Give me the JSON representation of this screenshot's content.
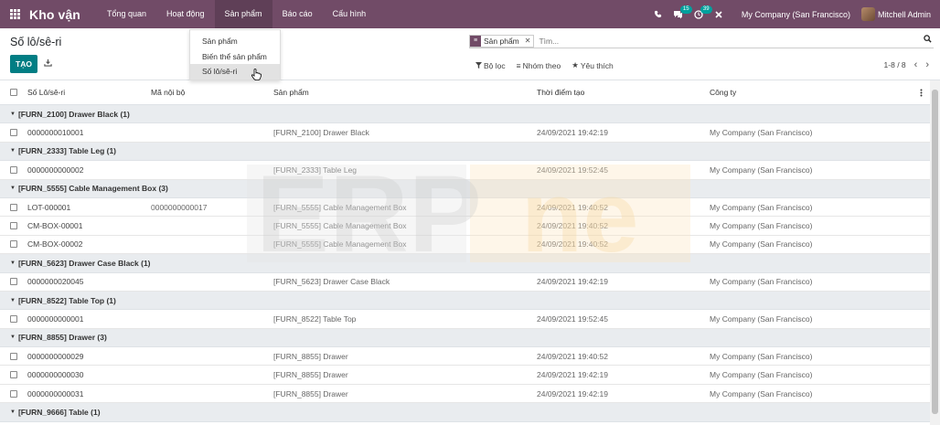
{
  "navbar": {
    "app_title": "Kho vận",
    "menu": [
      "Tổng quan",
      "Hoạt động",
      "Sản phẩm",
      "Báo cáo",
      "Cấu hình"
    ],
    "active_menu": "Sản phẩm",
    "chat_count": "15",
    "activity_count": "39",
    "company": "My Company (San Francisco)",
    "user": "Mitchell Admin"
  },
  "control_panel": {
    "breadcrumb": "Số lô/sê-ri",
    "create_label": "TẠO",
    "search_facet": "Sản phẩm",
    "search_placeholder": "Tìm...",
    "filter_label": "Bộ lọc",
    "groupby_label": "Nhóm theo",
    "favorite_label": "Yêu thích",
    "pager": "1-8 / 8"
  },
  "dropdown": {
    "items": [
      "Sản phẩm",
      "Biến thể sản phẩm",
      "Số lô/sê-ri"
    ],
    "active_index": 2
  },
  "table": {
    "columns": [
      "Số Lô/sê-ri",
      "Mã nội bộ",
      "Sản phẩm",
      "Thời điểm tạo",
      "Công ty"
    ],
    "groups": [
      {
        "label": "[FURN_2100] Drawer Black (1)",
        "rows": [
          {
            "lot": "0000000010001",
            "ref": "",
            "product": "[FURN_2100] Drawer Black",
            "date": "24/09/2021 19:42:19",
            "company": "My Company (San Francisco)"
          }
        ]
      },
      {
        "label": "[FURN_2333] Table Leg (1)",
        "rows": [
          {
            "lot": "0000000000002",
            "ref": "",
            "product": "[FURN_2333] Table Leg",
            "date": "24/09/2021 19:52:45",
            "company": "My Company (San Francisco)"
          }
        ]
      },
      {
        "label": "[FURN_5555] Cable Management Box (3)",
        "rows": [
          {
            "lot": "LOT-000001",
            "ref": "0000000000017",
            "product": "[FURN_5555] Cable Management Box",
            "date": "24/09/2021 19:40:52",
            "company": "My Company (San Francisco)"
          },
          {
            "lot": "CM-BOX-00001",
            "ref": "",
            "product": "[FURN_5555] Cable Management Box",
            "date": "24/09/2021 19:40:52",
            "company": "My Company (San Francisco)"
          },
          {
            "lot": "CM-BOX-00002",
            "ref": "",
            "product": "[FURN_5555] Cable Management Box",
            "date": "24/09/2021 19:40:52",
            "company": "My Company (San Francisco)"
          }
        ]
      },
      {
        "label": "[FURN_5623] Drawer Case Black (1)",
        "rows": [
          {
            "lot": "0000000020045",
            "ref": "",
            "product": "[FURN_5623] Drawer Case Black",
            "date": "24/09/2021 19:42:19",
            "company": "My Company (San Francisco)"
          }
        ]
      },
      {
        "label": "[FURN_8522] Table Top (1)",
        "rows": [
          {
            "lot": "0000000000001",
            "ref": "",
            "product": "[FURN_8522] Table Top",
            "date": "24/09/2021 19:52:45",
            "company": "My Company (San Francisco)"
          }
        ]
      },
      {
        "label": "[FURN_8855] Drawer (3)",
        "rows": [
          {
            "lot": "0000000000029",
            "ref": "",
            "product": "[FURN_8855] Drawer",
            "date": "24/09/2021 19:40:52",
            "company": "My Company (San Francisco)"
          },
          {
            "lot": "0000000000030",
            "ref": "",
            "product": "[FURN_8855] Drawer",
            "date": "24/09/2021 19:42:19",
            "company": "My Company (San Francisco)"
          },
          {
            "lot": "0000000000031",
            "ref": "",
            "product": "[FURN_8855] Drawer",
            "date": "24/09/2021 19:42:19",
            "company": "My Company (San Francisco)"
          }
        ]
      },
      {
        "label": "[FURN_9666] Table (1)",
        "rows": []
      }
    ]
  },
  "watermark": {
    "text_left": "ERP",
    "text_right": "ne",
    "color_left": "#c9c9c9",
    "color_right": "#f6d7a0"
  },
  "colors": {
    "brand": "#714b67",
    "primary_button": "#017e84",
    "badge": "#00a09d"
  }
}
